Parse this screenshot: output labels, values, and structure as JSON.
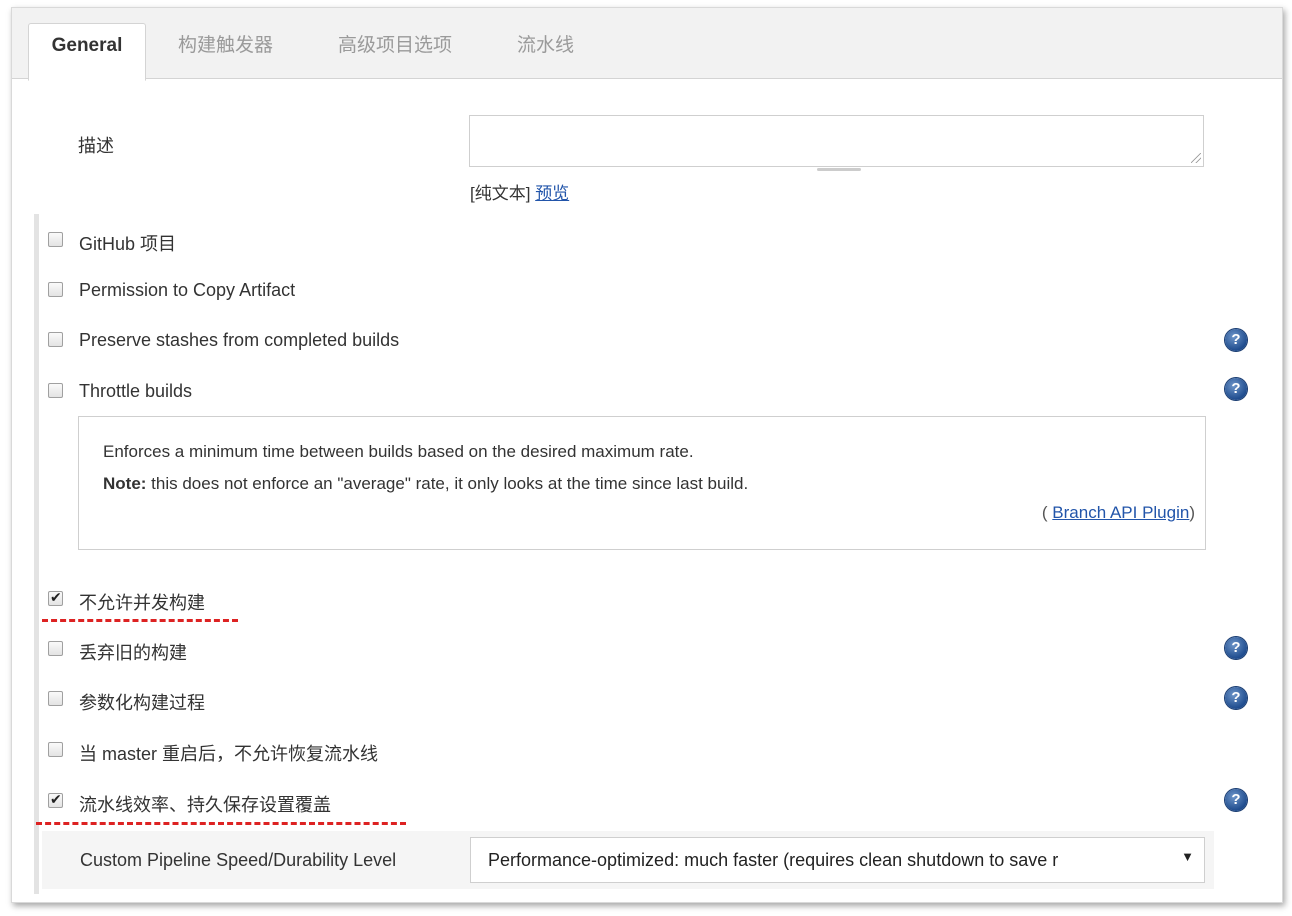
{
  "tabs": [
    {
      "label": "General",
      "active": true
    },
    {
      "label": "构建触发器"
    },
    {
      "label": "高级项目选项"
    },
    {
      "label": "流水线"
    }
  ],
  "description": {
    "label": "描述",
    "value": "",
    "format_prefix": "[纯文本]",
    "preview_link": "预览"
  },
  "options": [
    {
      "label": "GitHub 项目",
      "checked": false,
      "help": false
    },
    {
      "label": "Permission to Copy Artifact",
      "checked": false,
      "help": false
    },
    {
      "label": "Preserve stashes from completed builds",
      "checked": false,
      "help": true
    },
    {
      "label": "Throttle builds",
      "checked": false,
      "help": true
    },
    {
      "label": "不允许并发构建",
      "checked": true,
      "help": false
    },
    {
      "label": "丢弃旧的构建",
      "checked": false,
      "help": true
    },
    {
      "label": "参数化构建过程",
      "checked": false,
      "help": true
    },
    {
      "label": "当 master 重启后，不允许恢复流水线",
      "checked": false,
      "help": false
    },
    {
      "label": "流水线效率、持久保存设置覆盖",
      "checked": true,
      "help": true
    }
  ],
  "throttle_help": {
    "line1": "Enforces a minimum time between builds based on the desired maximum rate.",
    "note_label": "Note:",
    "note_text": " this does not enforce an \"average\" rate, it only looks at the time since last build.",
    "plugin_open": "( ",
    "plugin_link": "Branch API Plugin",
    "plugin_close": ")"
  },
  "speed": {
    "label": "Custom Pipeline Speed/Durability Level",
    "selected": "Performance-optimized: much faster (requires clean shutdown to save r"
  },
  "help_icon": "question-mark-icon",
  "colors": {
    "annotation": "#dd2222",
    "link": "#2255aa",
    "help": "#1f4c8e"
  }
}
